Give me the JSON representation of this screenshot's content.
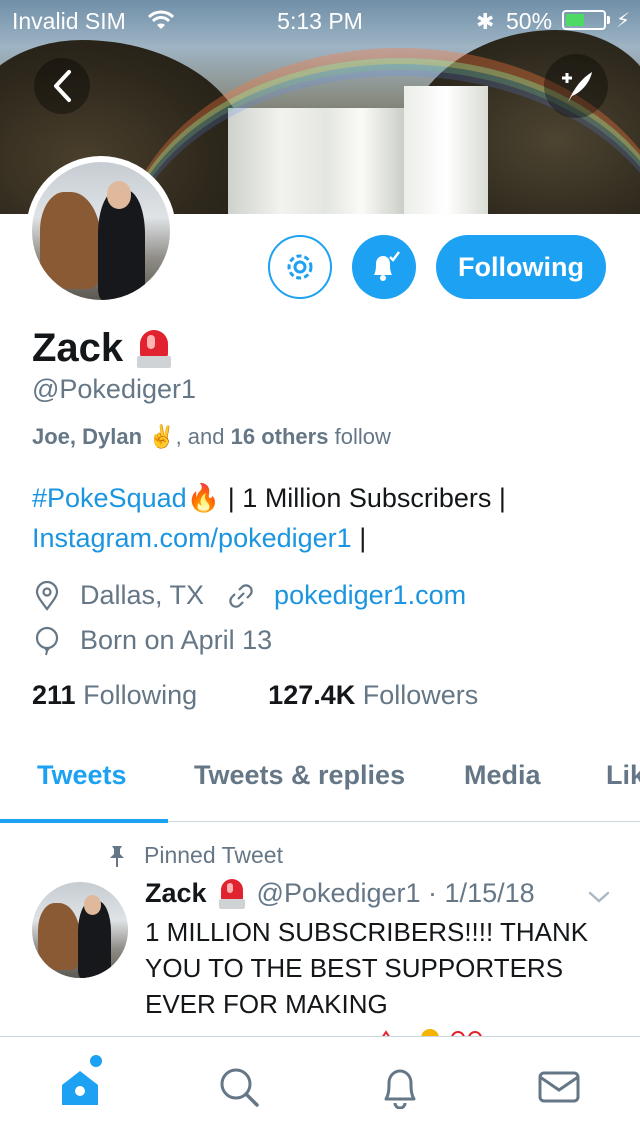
{
  "status_bar": {
    "carrier": "Invalid SIM",
    "time": "5:13 PM",
    "battery_pct": "50%",
    "battery_level": 0.5
  },
  "profile": {
    "name": "Zack",
    "handle": "@Pokediger1",
    "followed_by": {
      "names": "Joe, Dylan",
      "middle": ", and",
      "others": "16 others",
      "suffix": "follow"
    },
    "bio": {
      "hashtag": "#PokeSquad",
      "text": "| 1 Million Subscribers |",
      "link": "Instagram.com/pokediger1",
      "trail": "|"
    },
    "location": "Dallas, TX",
    "website": "pokediger1.com",
    "birthday": "Born on April 13",
    "following_count": "211",
    "following_label": "Following",
    "followers_count": "127.4K",
    "followers_label": "Followers"
  },
  "actions": {
    "following_button": "Following"
  },
  "tabs": [
    {
      "label": "Tweets",
      "active": true
    },
    {
      "label": "Tweets & replies",
      "active": false
    },
    {
      "label": "Media",
      "active": false
    },
    {
      "label": "Lik",
      "active": false
    }
  ],
  "pinned_tweet": {
    "pinned_label": "Pinned Tweet",
    "author": "Zack",
    "handle_date": "@Pokediger1 · 1/15/18",
    "text": "1 MILLION SUBSCRIBERS!!!! THANK YOU TO THE BEST SUPPORTERS EVER FOR MAKING"
  },
  "colors": {
    "accent": "#1da1f2",
    "link": "#1b95e0",
    "muted": "#657786"
  },
  "icons": {
    "back": "chevron-left-icon",
    "compose": "compose-tweet-icon",
    "settings": "gear-icon",
    "notify": "bell-check-icon",
    "location": "location-pin-icon",
    "website": "link-icon",
    "birthday": "balloon-icon",
    "pin": "pin-icon",
    "chevron": "chevron-down-icon",
    "home": "home-icon",
    "search": "search-icon",
    "notifications": "bell-icon",
    "messages": "mail-icon"
  }
}
